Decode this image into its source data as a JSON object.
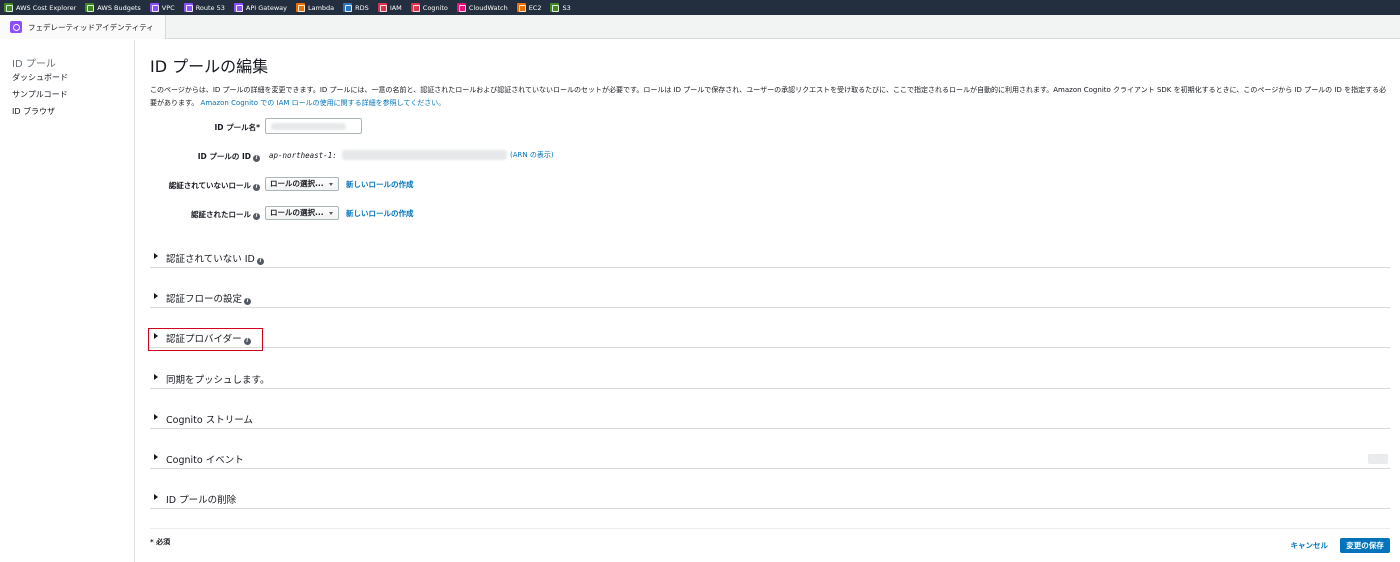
{
  "favorites": [
    {
      "label": "AWS Cost Explorer",
      "icon": "cost-explorer-icon",
      "color": "#3f8624"
    },
    {
      "label": "AWS Budgets",
      "icon": "budgets-icon",
      "color": "#3f8624"
    },
    {
      "label": "VPC",
      "icon": "vpc-icon",
      "color": "#8c4fff"
    },
    {
      "label": "Route 53",
      "icon": "route53-icon",
      "color": "#8c4fff"
    },
    {
      "label": "API Gateway",
      "icon": "api-gateway-icon",
      "color": "#8c4fff"
    },
    {
      "label": "Lambda",
      "icon": "lambda-icon",
      "color": "#ed7100"
    },
    {
      "label": "RDS",
      "icon": "rds-icon",
      "color": "#2e73b8"
    },
    {
      "label": "IAM",
      "icon": "iam-icon",
      "color": "#dd344c"
    },
    {
      "label": "Cognito",
      "icon": "cognito-icon",
      "color": "#dd344c"
    },
    {
      "label": "CloudWatch",
      "icon": "cloudwatch-icon",
      "color": "#e7157b"
    },
    {
      "label": "EC2",
      "icon": "ec2-icon",
      "color": "#ed7100"
    },
    {
      "label": "S3",
      "icon": "s3-icon",
      "color": "#3f8624"
    }
  ],
  "service": {
    "title": "フェデレーティッドアイデンティティ",
    "icon": "cognito-icon",
    "color": "#8c4fff"
  },
  "sidebar": {
    "title": "ID プール",
    "items": [
      {
        "label": "ダッシュボード"
      },
      {
        "label": "サンプルコード"
      },
      {
        "label": "ID ブラウザ"
      }
    ]
  },
  "main": {
    "title": "ID プールの編集",
    "description": "このページからは、ID プールの詳細を変更できます。ID プールには、一意の名前と、認証されたロールおよび認証されていないロールのセットが必要です。ロールは ID プールで保存され、ユーザーの承認リクエストを受け取るたびに、ここで指定されるロールが自動的に利用されます。Amazon Cognito クライアント SDK を初期化するときに、このページから ID プールの ID を指定する必要があります。",
    "description_link": "Amazon Cognito での IAM ロールの使用に関する詳細を参照してください。"
  },
  "form": {
    "pool_name_label": "ID プール名*",
    "pool_id_label": "ID プールの ID",
    "pool_id_prefix": "ap-northeast-1:",
    "arn_link": "(ARN の表示)",
    "unauth_role_label": "認証されていないロール",
    "auth_role_label": "認証されたロール",
    "select_placeholder": "ロールの選択...",
    "create_role_link": "新しいロールの作成"
  },
  "sections": [
    {
      "label": "認証されていない ID",
      "info": true
    },
    {
      "label": "認証フローの設定",
      "info": true
    },
    {
      "label": "認証プロバイダー",
      "info": true,
      "highlighted": true
    },
    {
      "label": "同期をプッシュします。",
      "info": false
    },
    {
      "label": "Cognito ストリーム",
      "info": false
    },
    {
      "label": "Cognito イベント",
      "info": false
    },
    {
      "label": "ID プールの削除",
      "info": false
    }
  ],
  "footer": {
    "required_note": "* 必須",
    "cancel": "キャンセル",
    "save": "変更の保存"
  },
  "colors": {
    "link": "#0073bb",
    "highlight": "#d0021b",
    "primary_button": "#0073bb"
  }
}
